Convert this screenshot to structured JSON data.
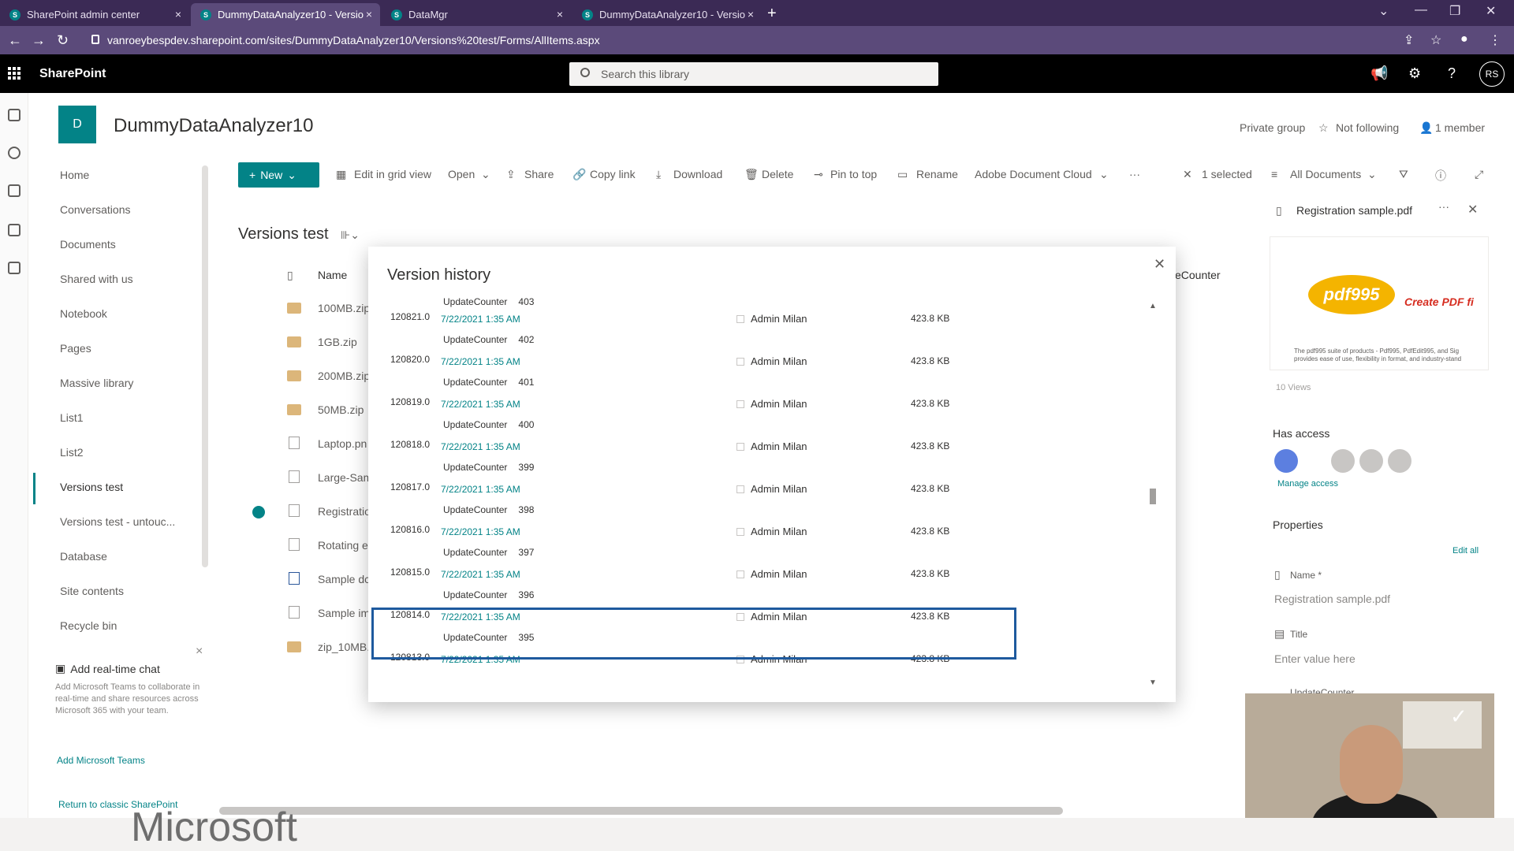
{
  "browser": {
    "tabs": [
      {
        "title": "SharePoint admin center"
      },
      {
        "title": "DummyDataAnalyzer10 - Versio"
      },
      {
        "title": "DataMgr"
      },
      {
        "title": "DummyDataAnalyzer10 - Versio"
      }
    ],
    "url": "vanroeybespdev.sharepoint.com/sites/DummyDataAnalyzer10/Versions%20test/Forms/AllItems.aspx"
  },
  "suite": {
    "brand": "SharePoint",
    "search_placeholder": "Search this library",
    "avatar": "RS"
  },
  "site": {
    "logo_letter": "D",
    "title": "DummyDataAnalyzer10",
    "privacy": "Private group",
    "follow": "Not following",
    "members": "1 member"
  },
  "leftnav": {
    "items": [
      "Home",
      "Conversations",
      "Documents",
      "Shared with us",
      "Notebook",
      "Pages",
      "Massive library",
      "List1",
      "List2",
      "Versions test",
      "Versions test - untouc...",
      "Database",
      "Site contents",
      "Recycle bin"
    ],
    "chat_title": "Add real-time chat",
    "chat_desc": "Add Microsoft Teams to collaborate in real-time and share resources across Microsoft 365 with your team.",
    "chat_link": "Add Microsoft Teams",
    "classic_link": "Return to classic SharePoint"
  },
  "commandbar": {
    "new": "New",
    "edit_grid": "Edit in grid view",
    "open": "Open",
    "share": "Share",
    "copy_link": "Copy link",
    "download": "Download",
    "delete": "Delete",
    "pin": "Pin to top",
    "rename": "Rename",
    "adobe": "Adobe Document Cloud",
    "more": "···",
    "selected": "1 selected",
    "view": "All Documents"
  },
  "library": {
    "title": "Versions test",
    "col_name": "Name",
    "col_counter": "eCounter",
    "files": [
      {
        "name": "100MB.zip",
        "type": "folder"
      },
      {
        "name": "1GB.zip",
        "type": "folder"
      },
      {
        "name": "200MB.zip",
        "type": "folder"
      },
      {
        "name": "50MB.zip",
        "type": "folder"
      },
      {
        "name": "Laptop.pn",
        "type": "doc"
      },
      {
        "name": "Large-Sam",
        "type": "doc"
      },
      {
        "name": "Registratio",
        "type": "doc"
      },
      {
        "name": "Rotating e",
        "type": "doc"
      },
      {
        "name": "Sample dc",
        "type": "doc"
      },
      {
        "name": "Sample im",
        "type": "doc"
      },
      {
        "name": "zip_10MB.",
        "type": "folder"
      }
    ]
  },
  "pane": {
    "file": "Registration sample.pdf",
    "pdf_logo": "pdf995",
    "pdf_tag": "Create PDF fi",
    "pdf_body": "The pdf995 suite of products - Pdf995, PdfEdit995, and Sig provides ease of use, flexibility in format, and industry-stand",
    "views": "10 Views",
    "has_access": "Has access",
    "manage_access": "Manage access",
    "properties": "Properties",
    "edit_all": "Edit all",
    "name_label": "Name *",
    "name_value": "Registration sample.pdf",
    "title_label": "Title",
    "title_placeholder": "Enter value here",
    "counter_label": "UpdateCounter"
  },
  "dialog": {
    "title": "Version history",
    "counter_label": "UpdateCounter",
    "top_counter": "403",
    "versions": [
      {
        "num": "120821.0",
        "date": "7/22/2021 1:35 AM",
        "user": "Admin Milan",
        "size": "423.8 KB",
        "counter": "402"
      },
      {
        "num": "120820.0",
        "date": "7/22/2021 1:35 AM",
        "user": "Admin Milan",
        "size": "423.8 KB",
        "counter": "401"
      },
      {
        "num": "120819.0",
        "date": "7/22/2021 1:35 AM",
        "user": "Admin Milan",
        "size": "423.8 KB",
        "counter": "400"
      },
      {
        "num": "120818.0",
        "date": "7/22/2021 1:35 AM",
        "user": "Admin Milan",
        "size": "423.8 KB",
        "counter": "399"
      },
      {
        "num": "120817.0",
        "date": "7/22/2021 1:35 AM",
        "user": "Admin Milan",
        "size": "423.8 KB",
        "counter": "398"
      },
      {
        "num": "120816.0",
        "date": "7/22/2021 1:35 AM",
        "user": "Admin Milan",
        "size": "423.8 KB",
        "counter": "397"
      },
      {
        "num": "120815.0",
        "date": "7/22/2021 1:35 AM",
        "user": "Admin Milan",
        "size": "423.8 KB",
        "counter": "396"
      },
      {
        "num": "120814.0",
        "date": "7/22/2021 1:35 AM",
        "user": "Admin Milan",
        "size": "423.8 KB",
        "counter": "395"
      },
      {
        "num": "120813.0",
        "date": "7/22/2021 1:35 AM",
        "user": "Admin Milan",
        "size": "423.8 KB",
        "counter": ""
      }
    ]
  },
  "watermark": "Microsoft",
  "colors": {
    "accent": "#038387",
    "highlight": "#1e5a9e",
    "browser": "#3b2a55"
  }
}
